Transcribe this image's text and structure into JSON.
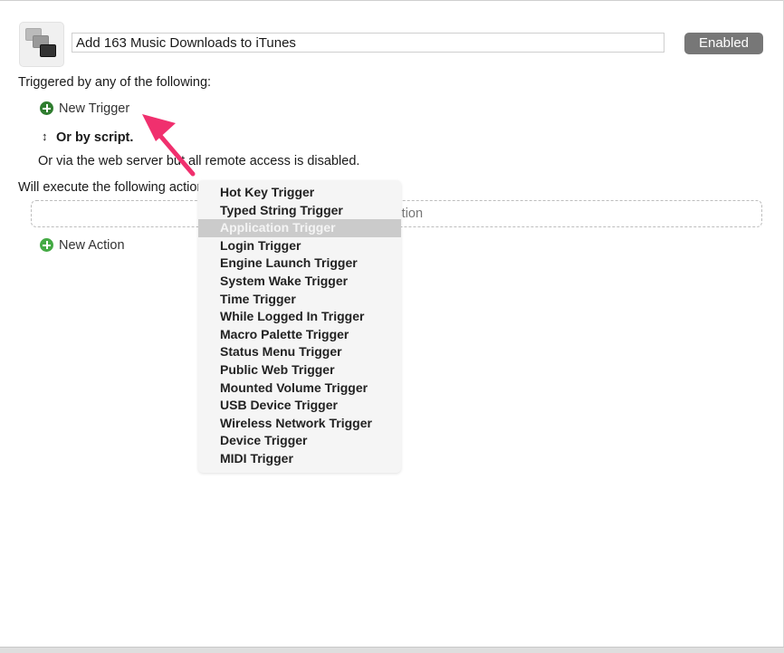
{
  "macro": {
    "name": "Add 163 Music Downloads to iTunes",
    "enabled_label": "Enabled"
  },
  "triggers": {
    "heading": "Triggered by any of the following:",
    "new_trigger": "New Trigger",
    "or_by_script": "Or by script.",
    "web_server_note": "Or via the web server but all remote access is disabled."
  },
  "actions": {
    "heading": "Will execute the following actions:",
    "drop_placeholder": "No Action",
    "new_action": "New Action"
  },
  "annotation": {
    "arrow_color": "#f0306e"
  },
  "trigger_menu": {
    "selected": "Application Trigger",
    "items": [
      "Hot Key Trigger",
      "Typed String Trigger",
      "Application Trigger",
      "Login Trigger",
      "Engine Launch Trigger",
      "System Wake Trigger",
      "Time Trigger",
      "While Logged In Trigger",
      "Macro Palette Trigger",
      "Status Menu Trigger",
      "Public Web Trigger",
      "Mounted Volume Trigger",
      "USB Device Trigger",
      "Wireless Network Trigger",
      "Device Trigger",
      "MIDI Trigger"
    ]
  }
}
